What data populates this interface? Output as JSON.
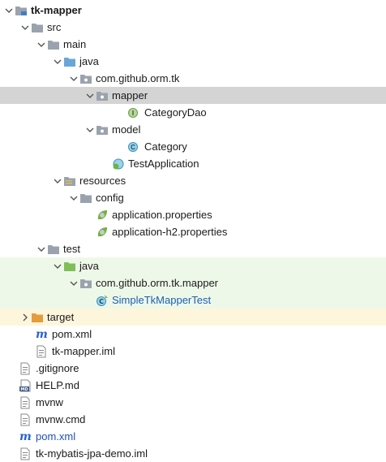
{
  "tree": {
    "root": {
      "label": "tk-mapper",
      "icon": "module-folder-icon"
    },
    "src": {
      "label": "src"
    },
    "main": {
      "label": "main"
    },
    "java_main": {
      "label": "java"
    },
    "pkg_main": {
      "label": "com.github.orm.tk"
    },
    "mapper": {
      "label": "mapper"
    },
    "category_dao": {
      "label": "CategoryDao",
      "icon_letter": "I"
    },
    "model": {
      "label": "model"
    },
    "category": {
      "label": "Category",
      "icon_letter": "C"
    },
    "test_application": {
      "label": "TestApplication"
    },
    "resources": {
      "label": "resources"
    },
    "config": {
      "label": "config"
    },
    "app_props": {
      "label": "application.properties"
    },
    "app_h2_props": {
      "label": "application-h2.properties"
    },
    "test": {
      "label": "test"
    },
    "java_test": {
      "label": "java"
    },
    "pkg_test": {
      "label": "com.github.orm.tk.mapper"
    },
    "simple_test": {
      "label": "SimpleTkMapperTest"
    },
    "target": {
      "label": "target"
    },
    "module_pom": {
      "label": "pom.xml",
      "icon_letter": "m"
    },
    "module_iml": {
      "label": "tk-mapper.iml"
    },
    "gitignore": {
      "label": ".gitignore"
    },
    "help": {
      "label": "HELP.md",
      "icon_letter": "MD"
    },
    "mvnw": {
      "label": "mvnw"
    },
    "mvnw_cmd": {
      "label": "mvnw.cmd"
    },
    "root_pom": {
      "label": "pom.xml",
      "icon_letter": "m"
    },
    "root_iml": {
      "label": "tk-mybatis-jpa-demo.iml"
    }
  },
  "colors": {
    "selected_row": "#d4d4d4",
    "test_row": "#eef8e9",
    "excluded_row": "#fdf6dc",
    "folder_gray": "#9aa3ad",
    "java_source_blue": "#6aa7d6",
    "test_source_green": "#7fbf5a",
    "target_orange": "#e59c3a"
  }
}
